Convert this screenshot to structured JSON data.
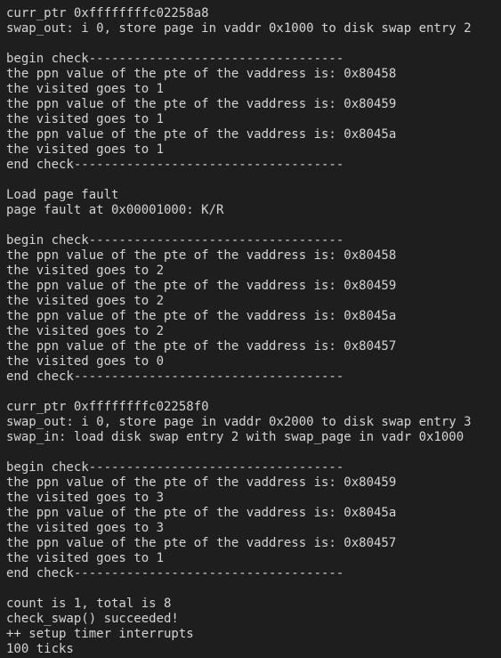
{
  "terminal": {
    "lines": [
      "curr_ptr 0xffffffffc02258a8",
      "swap_out: i 0, store page in vaddr 0x1000 to disk swap entry 2",
      "",
      "begin check----------------------------------",
      "the ppn value of the pte of the vaddress is: 0x80458",
      "the visited goes to 1",
      "the ppn value of the pte of the vaddress is: 0x80459",
      "the visited goes to 1",
      "the ppn value of the pte of the vaddress is: 0x8045a",
      "the visited goes to 1",
      "end check------------------------------------",
      "",
      "Load page fault",
      "page fault at 0x00001000: K/R",
      "",
      "begin check----------------------------------",
      "the ppn value of the pte of the vaddress is: 0x80458",
      "the visited goes to 2",
      "the ppn value of the pte of the vaddress is: 0x80459",
      "the visited goes to 2",
      "the ppn value of the pte of the vaddress is: 0x8045a",
      "the visited goes to 2",
      "the ppn value of the pte of the vaddress is: 0x80457",
      "the visited goes to 0",
      "end check------------------------------------",
      "",
      "curr_ptr 0xffffffffc02258f0",
      "swap_out: i 0, store page in vaddr 0x2000 to disk swap entry 3",
      "swap_in: load disk swap entry 2 with swap_page in vadr 0x1000",
      "",
      "begin check----------------------------------",
      "the ppn value of the pte of the vaddress is: 0x80459",
      "the visited goes to 3",
      "the ppn value of the pte of the vaddress is: 0x8045a",
      "the visited goes to 3",
      "the ppn value of the pte of the vaddress is: 0x80457",
      "the visited goes to 1",
      "end check------------------------------------",
      "",
      "count is 1, total is 8",
      "check_swap() succeeded!",
      "++ setup timer interrupts",
      "100 ticks"
    ]
  }
}
